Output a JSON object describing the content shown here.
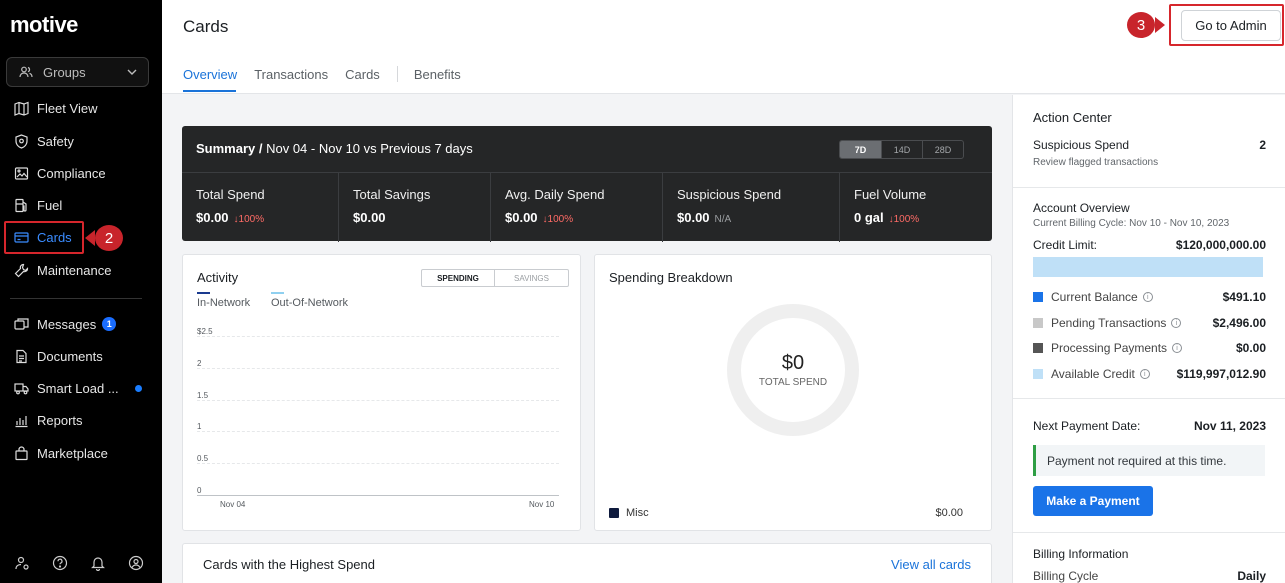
{
  "app": {
    "logo": "motive"
  },
  "sidebar": {
    "groups_label": "Groups",
    "items": [
      {
        "label": "Fleet View"
      },
      {
        "label": "Safety"
      },
      {
        "label": "Compliance"
      },
      {
        "label": "Fuel"
      },
      {
        "label": "Cards"
      },
      {
        "label": "Maintenance"
      },
      {
        "label": "Messages",
        "badge": "1"
      },
      {
        "label": "Documents"
      },
      {
        "label": "Smart Load ..."
      },
      {
        "label": "Reports"
      },
      {
        "label": "Marketplace"
      }
    ]
  },
  "callouts": {
    "cards": "2",
    "admin": "3"
  },
  "header": {
    "title": "Cards",
    "tabs": [
      "Overview",
      "Transactions",
      "Cards",
      "Benefits"
    ],
    "admin_button": "Go to Admin"
  },
  "summary": {
    "title_bold": "Summary /",
    "title_rest": " Nov 04 - Nov 10 vs Previous 7 days",
    "ranges": [
      "7D",
      "14D",
      "28D"
    ],
    "metrics": [
      {
        "label": "Total Spend",
        "value": "$0.00",
        "delta": "↓100%"
      },
      {
        "label": "Total Savings",
        "value": "$0.00",
        "delta": ""
      },
      {
        "label": "Avg. Daily Spend",
        "value": "$0.00",
        "delta": "↓100%"
      },
      {
        "label": "Suspicious Spend",
        "value": "$0.00",
        "na": "N/A"
      },
      {
        "label": "Fuel Volume",
        "value": "0 gal",
        "delta": "↓100%"
      }
    ]
  },
  "activity": {
    "title": "Activity",
    "toggle": [
      "SPENDING",
      "SAVINGS"
    ],
    "legend": [
      "In-Network",
      "Out-Of-Network"
    ],
    "colors": {
      "in_network": "#1a3a8f",
      "out_network": "#8fd0f0"
    }
  },
  "chart_data": {
    "type": "line",
    "x": [
      "Nov 04",
      "Nov 10"
    ],
    "yticks": [
      "$2.5",
      "2",
      "1.5",
      "1",
      "0.5",
      "0"
    ],
    "ylim": [
      0,
      2.5
    ],
    "series": [
      {
        "name": "In-Network",
        "values": []
      },
      {
        "name": "Out-Of-Network",
        "values": []
      }
    ]
  },
  "breakdown": {
    "title": "Spending Breakdown",
    "center_amount": "$0",
    "center_label": "TOTAL SPEND",
    "legend_label": "Misc",
    "legend_amount": "$0.00"
  },
  "cards_section": {
    "title": "Cards with the Highest Spend",
    "link": "View all cards"
  },
  "right": {
    "action_center": "Action Center",
    "suspicious_label": "Suspicious Spend",
    "suspicious_count": "2",
    "suspicious_sub": "Review flagged transactions",
    "account_overview": "Account Overview",
    "billing_cycle_line": "Current Billing Cycle: Nov 10 - Nov 10, 2023",
    "credit_limit_label": "Credit Limit:",
    "credit_limit_value": "$120,000,000.00",
    "balances": [
      {
        "label": "Current Balance",
        "value": "$491.10",
        "color": "#1a73e8"
      },
      {
        "label": "Pending Transactions",
        "value": "$2,496.00",
        "color": "#c8c8c8"
      },
      {
        "label": "Processing Payments",
        "value": "$0.00",
        "color": "#555555"
      },
      {
        "label": "Available Credit",
        "value": "$119,997,012.90",
        "color": "#bfe0f7"
      }
    ],
    "next_payment_label": "Next Payment Date:",
    "next_payment_value": "Nov 11, 2023",
    "notice": "Payment not required at this time.",
    "pay_button": "Make a Payment",
    "billing_info": "Billing Information",
    "billing_cycle_label": "Billing Cycle",
    "billing_cycle_value": "Daily"
  }
}
